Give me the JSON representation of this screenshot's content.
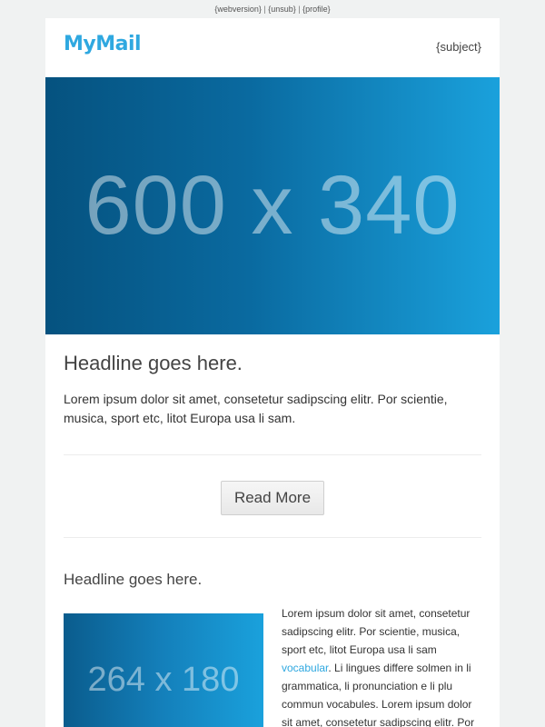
{
  "topbar": {
    "webversion": "{webversion}",
    "unsub": "{unsub}",
    "profile": "{profile}",
    "separator": "|"
  },
  "header": {
    "logo": "MyMail",
    "subject": "{subject}"
  },
  "hero": {
    "placeholder": "600 x 340"
  },
  "section1": {
    "headline": "Headline goes here.",
    "text": "Lorem ipsum dolor sit amet, consetetur sadipscing elitr. Por scientie, musica, sport etc, litot Europa usa li sam."
  },
  "cta": {
    "label": "Read More"
  },
  "section2": {
    "headline": "Headline goes here.",
    "thumb_placeholder": "264 x 180",
    "text_before_link": "Lorem ipsum dolor sit amet, consetetur sadipscing elitr. Por scientie, musica, sport etc, litot Europa usa li sam",
    "link": "vocabular",
    "text_after_link": ". Li lingues differe solmen in li grammatica, li pronunciation e li plu commun vocabules. Lorem ipsum dolor sit amet, consetetur sadipscing elitr. Por"
  },
  "colors": {
    "accent": "#2fa8e0",
    "background": "#f0f2f2",
    "hero_dark": "#05527f",
    "hero_light": "#1aa1dc"
  }
}
